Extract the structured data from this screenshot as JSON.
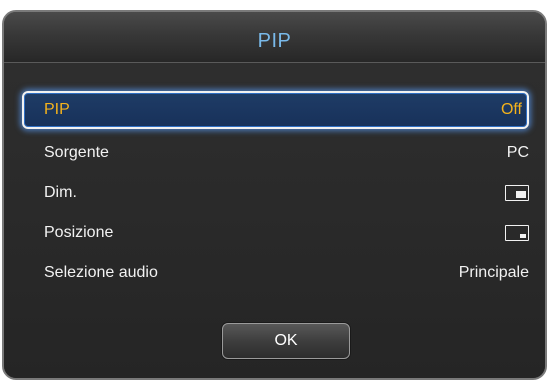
{
  "dialog": {
    "title": "PIP"
  },
  "menu": {
    "items": [
      {
        "label": "PIP",
        "value": "Off",
        "selected": true
      },
      {
        "label": "Sorgente",
        "value": "PC"
      },
      {
        "label": "Dim.",
        "icon": "pip-size-large-icon"
      },
      {
        "label": "Posizione",
        "icon": "pip-position-bottom-right-icon"
      },
      {
        "label": "Selezione audio",
        "value": "Principale"
      }
    ]
  },
  "buttons": {
    "ok_label": "OK"
  },
  "colors": {
    "title_text": "#79b9e9",
    "selected_text": "#f4b21c",
    "selected_border": "#f2f2f2",
    "selected_glow": "#5aa0ff",
    "text": "#f2f2f2",
    "background": "#2a2a2a"
  }
}
